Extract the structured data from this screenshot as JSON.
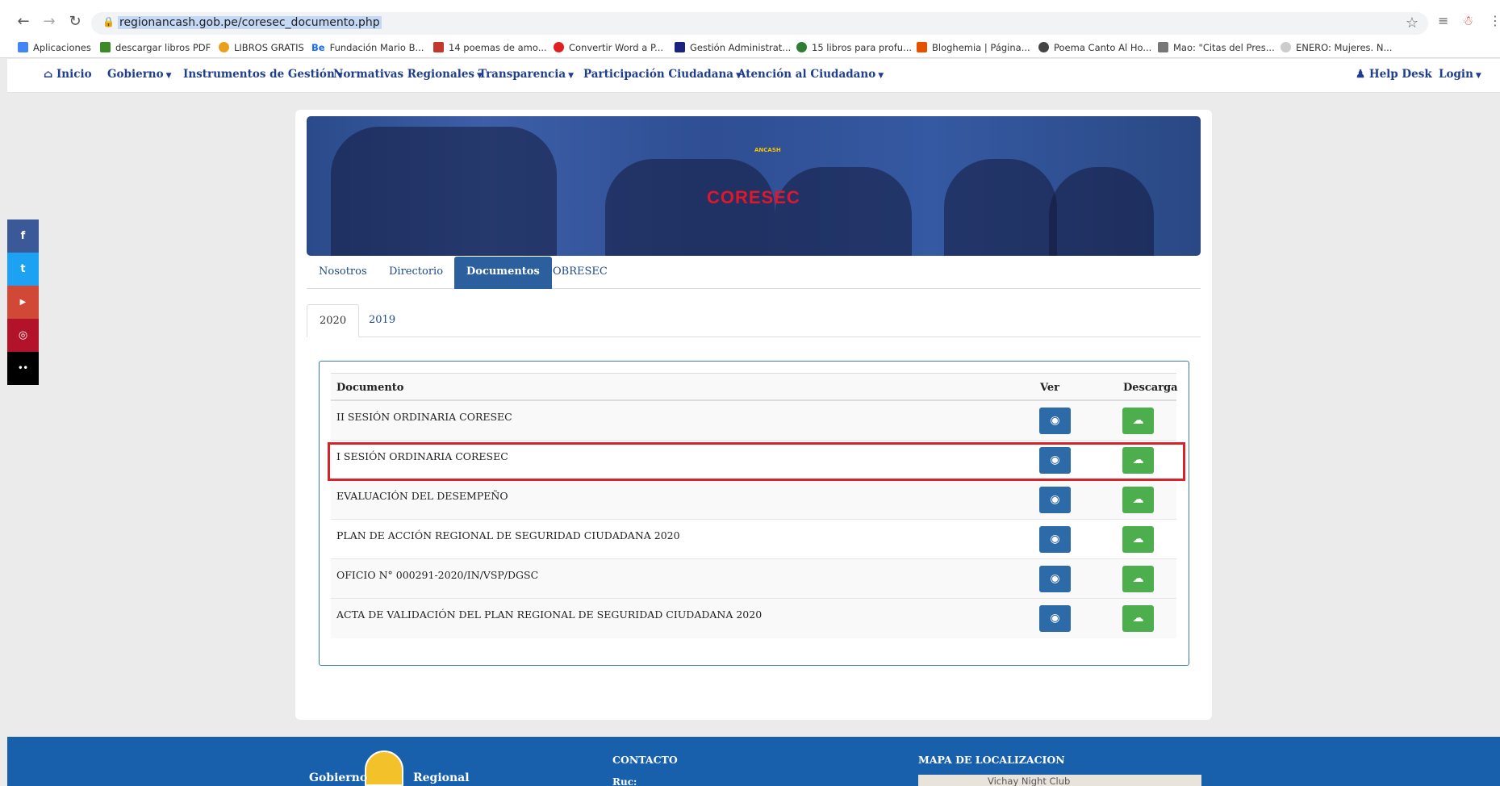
{
  "browser": {
    "url": "regionancash.gob.pe/coresec_documento.php",
    "bookmarks": [
      {
        "label": "Aplicaciones",
        "color": "#4285f4"
      },
      {
        "label": "descargar libros PDF",
        "color": "#3a8a2a"
      },
      {
        "label": "LIBROS GRATIS",
        "color": "#e8a020"
      },
      {
        "label": "Fundación Mario B...",
        "color": "#1769ff"
      },
      {
        "label": "14 poemas de amo...",
        "color": "#c0392b"
      },
      {
        "label": "Convertir Word a P...",
        "color": "#e02020"
      },
      {
        "label": "Gestión Administrat...",
        "color": "#1a237e"
      },
      {
        "label": "15 libros para profu...",
        "color": "#2e7d32"
      },
      {
        "label": "Bloghemia | Página...",
        "color": "#e65100"
      },
      {
        "label": "Poema Canto Al Ho...",
        "color": "#444444"
      },
      {
        "label": "Mao: \"Citas del Pres...",
        "color": "#777777"
      },
      {
        "label": "ENERO: Mujeres. N...",
        "color": "#bbbbbb"
      }
    ],
    "be_label": "Be"
  },
  "site_nav": {
    "inicio": "Inicio",
    "gobierno": "Gobierno",
    "instrumentos": "Instrumentos de Gestión",
    "normativas": "Normativas Regionales",
    "transparencia": "Transparencia",
    "participacion": "Participación Ciudadana",
    "atencion": "Atención al Ciudadano",
    "help_desk": "Help Desk",
    "login": "Login"
  },
  "social": [
    {
      "name": "facebook",
      "glyph": "f",
      "color": "#3b5998"
    },
    {
      "name": "twitter",
      "glyph": "t",
      "color": "#1da1f2"
    },
    {
      "name": "youtube",
      "glyph": "▶",
      "color": "#d14836"
    },
    {
      "name": "instagram",
      "glyph": "◎",
      "color": "#c13584"
    },
    {
      "name": "flickr",
      "glyph": "••",
      "color": "#111111"
    }
  ],
  "banner": {
    "title": "CORESEC",
    "small_text": "ANCASH"
  },
  "tabs": {
    "nosotros": "Nosotros",
    "directorio": "Directorio",
    "documentos": "Documentos",
    "obresec": "OBRESEC"
  },
  "years": {
    "y2020": "2020",
    "y2019": "2019"
  },
  "table": {
    "col_documento": "Documento",
    "col_ver": "Ver",
    "col_descarga": "Descarga",
    "rows": [
      "II SESIÓN ORDINARIA CORESEC",
      "I SESIÓN ORDINARIA CORESEC",
      "EVALUACIÓN DEL DESEMPEÑO",
      "PLAN DE ACCIÓN REGIONAL DE SEGURIDAD CIUDADANA 2020",
      "OFICIO N° 000291-2020/IN/VSP/DGSC",
      "ACTA DE VALIDACIÓN DEL PLAN REGIONAL DE SEGURIDAD CIUDADANA 2020"
    ],
    "highlighted_row": 1,
    "highlight_color": "#d8232a"
  },
  "footer": {
    "brand_left": "Gobierno",
    "brand_right": "Regional",
    "contacto": "CONTACTO",
    "ruc": "Ruc:",
    "mapa": "MAPA DE LOCALIZACION",
    "map_label": "Vichay Night Club"
  }
}
